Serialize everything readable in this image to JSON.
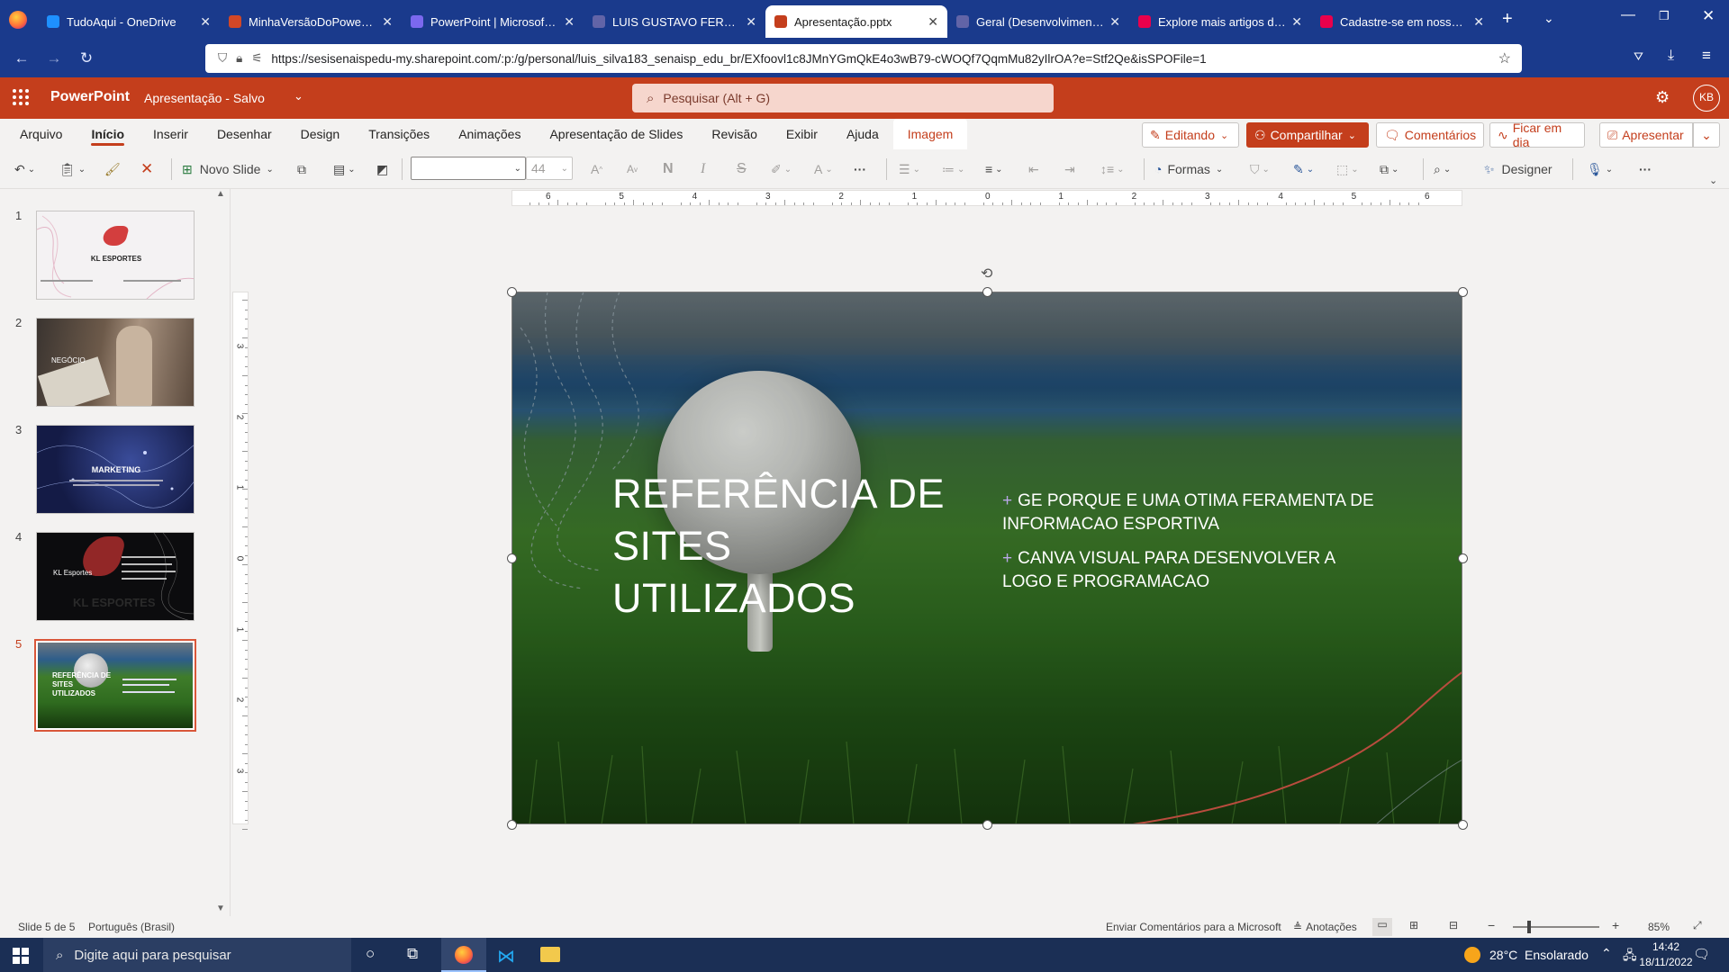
{
  "browser": {
    "tabs": [
      {
        "title": "TudoAqui - OneDrive",
        "color": "#1e90ff"
      },
      {
        "title": "MinhaVersãoDoPowerPoint",
        "color": "#d24726"
      },
      {
        "title": "PowerPoint | Microsoft 365",
        "color": "#7b68ee"
      },
      {
        "title": "LUIS GUSTAVO FERREIRA DA",
        "color": "#6264a7"
      },
      {
        "title": "Apresentação.pptx",
        "color": "#c43e1c",
        "active": true
      },
      {
        "title": "Geral (Desenvolvimento We",
        "color": "#6264a7"
      },
      {
        "title": "Explore mais artigos do nos",
        "color": "#e9004c"
      },
      {
        "title": "Cadastre-se em nossa news",
        "color": "#e9004c"
      }
    ],
    "url": "https://sesisenaispedu-my.sharepoint.com/:p:/g/personal/luis_silva183_senaisp_edu_br/EXfoovl1c8JMnYGmQkE4o3wB79-cWOQf7QqmMu82yIlrOA?e=Stf2Qe&isSPOFile=1"
  },
  "app": {
    "name": "PowerPoint",
    "doc_title": "Apresentação - Salvo",
    "search_placeholder": "Pesquisar (Alt + G)",
    "avatar": "KB"
  },
  "ribbon": {
    "tabs": [
      "Arquivo",
      "Início",
      "Inserir",
      "Desenhar",
      "Design",
      "Transições",
      "Animações",
      "Apresentação de Slides",
      "Revisão",
      "Exibir",
      "Ajuda",
      "Imagem"
    ],
    "selected": "Início",
    "editing": "Editando",
    "share": "Compartilhar",
    "comments": "Comentários",
    "catch_up": "Ficar em dia",
    "present": "Apresentar"
  },
  "toolbar": {
    "new_slide": "Novo Slide",
    "font_size": "44",
    "bold": "N",
    "italic": "I",
    "strike": "S",
    "shapes": "Formas",
    "designer": "Designer"
  },
  "thumbnails": [
    {
      "num": "1",
      "title": "KL ESPORTES"
    },
    {
      "num": "2",
      "title": "NEGÓCIO"
    },
    {
      "num": "3",
      "title": "MARKETING"
    },
    {
      "num": "4",
      "title": "KL Esportes"
    },
    {
      "num": "5",
      "title": "REFERÊNCIA DE SITES UTILIZADOS",
      "selected": true
    }
  ],
  "slide": {
    "title_lines": [
      "REFERÊNCIA DE",
      "SITES",
      "UTILIZADOS"
    ],
    "bullets": [
      "GE PORQUE E UMA OTIMA FERAMENTA DE INFORMACAO ESPORTIVA",
      "CANVA VISUAL PARA DESENVOLVER A LOGO E PROGRAMACAO"
    ]
  },
  "ruler_h_labels": [
    "6",
    "5",
    "4",
    "3",
    "2",
    "1",
    "0",
    "1",
    "2",
    "3",
    "4",
    "5",
    "6"
  ],
  "ruler_v_labels": [
    "3",
    "2",
    "1",
    "0",
    "1",
    "2",
    "3"
  ],
  "status": {
    "slide_of": "Slide 5 de 5",
    "language": "Português (Brasil)",
    "feedback": "Enviar Comentários para a Microsoft",
    "notes": "Anotações",
    "zoom": "85%"
  },
  "taskbar": {
    "search_placeholder": "Digite aqui para pesquisar",
    "weather": "28°C  Ensolarado",
    "time": "14:42",
    "date": "18/11/2022"
  }
}
